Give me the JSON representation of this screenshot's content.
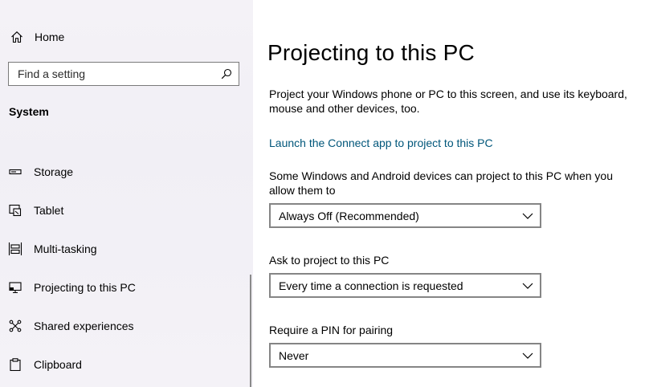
{
  "sidebar": {
    "home_label": "Home",
    "search": {
      "placeholder": "Find a setting",
      "value": ""
    },
    "section_title": "System",
    "items": [
      {
        "label": "Storage",
        "icon": "storage-icon"
      },
      {
        "label": "Tablet",
        "icon": "tablet-icon"
      },
      {
        "label": "Multi-tasking",
        "icon": "multitasking-icon"
      },
      {
        "label": "Projecting to this PC",
        "icon": "projecting-icon"
      },
      {
        "label": "Shared experiences",
        "icon": "shared-experiences-icon"
      },
      {
        "label": "Clipboard",
        "icon": "clipboard-icon"
      }
    ]
  },
  "main": {
    "title": "Projecting to this PC",
    "description": "Project your Windows phone or PC to this screen, and use its keyboard, mouse and other devices, too.",
    "link_text": "Launch the Connect app to project to this PC",
    "settings": [
      {
        "label": "Some Windows and Android devices can project to this PC when you allow them to",
        "value": "Always Off (Recommended)"
      },
      {
        "label": "Ask to project to this PC",
        "value": "Every time a connection is requested"
      },
      {
        "label": "Require a PIN for pairing",
        "value": "Never"
      }
    ]
  },
  "colors": {
    "link": "#00567a",
    "sidebar_bg": "#f3f1f6",
    "border": "#858585"
  }
}
